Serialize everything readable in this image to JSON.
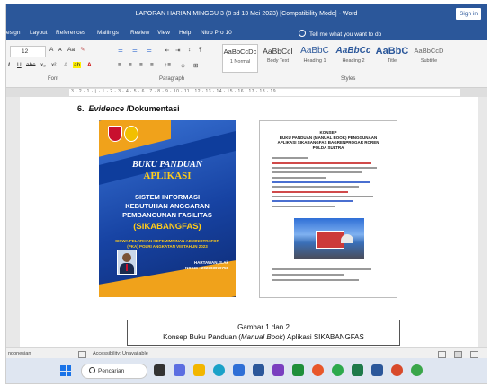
{
  "window": {
    "title": "LAPORAN HARIAN MINGGU 3 (8 sd 13 Mei 2023) [Compatibility Mode] - Word",
    "signin_label": "Sign in"
  },
  "ribbon_tabs": [
    "esign",
    "Layout",
    "References",
    "Mailings",
    "Review",
    "View",
    "Help",
    "Nitro Pro 10"
  ],
  "tell_me": "Tell me what you want to do",
  "ribbon": {
    "font_size": "12",
    "font_group_label": "Font",
    "paragraph_group_label": "Paragraph",
    "styles_group_label": "Styles",
    "styles": [
      {
        "preview": "AaBbCcDc",
        "name": "1 Normal"
      },
      {
        "preview": "AaBbCcI",
        "name": "Body Text"
      },
      {
        "preview": "AaBbC",
        "name": "Heading 1"
      },
      {
        "preview": "AaBbCc",
        "name": "Heading 2"
      },
      {
        "preview": "AaBbC",
        "name": "Title"
      },
      {
        "preview": "AaBbCcD",
        "name": "Subtitle"
      }
    ]
  },
  "ruler_ticks": "3 · 2 · 1 · ⌊ · 1 · 2 · 3 · 4 · 5 · 6 · 7 · 8 · 9 · 10 · 11 · 12 · 13 · 14 · 15 · 16 · 17 · 18 · 19",
  "document": {
    "heading_number": "6.",
    "heading_italic": "Evidence",
    "heading_rest": " /Dokumentasi",
    "cover": {
      "title_line1": "BUKU PANDUAN",
      "title_line2": "APLIKASI",
      "system_line1": "SISTEM INFORMASI",
      "system_line2": "KEBUTUHAN ANGGARAN",
      "system_line3": "PEMBANGUNAN FASILITAS",
      "acronym": "(SIKABANGFAS)",
      "training_line1": "SISWA PELATIHAN KEPEMIMPINAN ADMINISTRATOR",
      "training_line2": "(PKA) POLRI ANGKATAN VIII TAHUN 2023",
      "author_name": "HARTAWAN, S.Ak",
      "author_id": "NOSIS : 202303070758"
    },
    "konsep_page": {
      "title_line1": "KONSEP",
      "title_line2": "BUKU PANDUAN (MANUAL BOOK) PENGGUNAAN",
      "title_line3": "APLIKASI SIKABANGFAS BAGRENPROGAR ROREN",
      "title_line4": "POLDA SULTRA"
    },
    "caption_line1": "Gambar 1 dan 2",
    "caption_prefix": "Konsep Buku Panduan (",
    "caption_italic": "Manual Book",
    "caption_suffix": ") Aplikasi SIKABANGFAS"
  },
  "status": {
    "language": "ndonesian",
    "accessibility": "Accessibility: Unavailable"
  },
  "taskbar": {
    "search_label": "Pencarian"
  }
}
